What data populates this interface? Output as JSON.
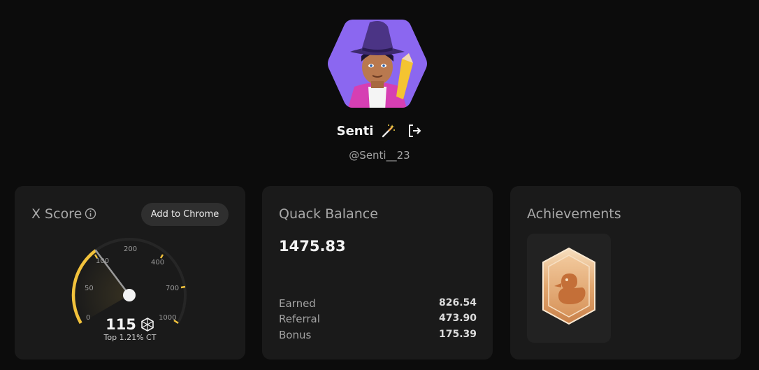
{
  "profile": {
    "name": "Senti",
    "handle": "@Senti__23"
  },
  "xscore": {
    "title": "X Score",
    "add_to_chrome": "Add to Chrome",
    "score": "115",
    "rank_text": "Top 1.21% CT",
    "gauge_ticks": [
      "0",
      "50",
      "100",
      "200",
      "400",
      "700",
      "1000"
    ],
    "accent_color": "#f2c23c"
  },
  "quack": {
    "title": "Quack Balance",
    "balance": "1475.83",
    "breakdown": [
      {
        "label": "Earned",
        "value": "826.54"
      },
      {
        "label": "Referral",
        "value": "473.90"
      },
      {
        "label": "Bonus",
        "value": "175.39"
      }
    ]
  },
  "achievements": {
    "title": "Achievements",
    "badges": [
      {
        "icon": "duck-badge-icon",
        "color": "#e0a878"
      }
    ]
  },
  "icons": {
    "wand": "magic-wand-icon",
    "logout": "logout-icon",
    "info": "info-icon",
    "score_unit": "cube-icon"
  }
}
